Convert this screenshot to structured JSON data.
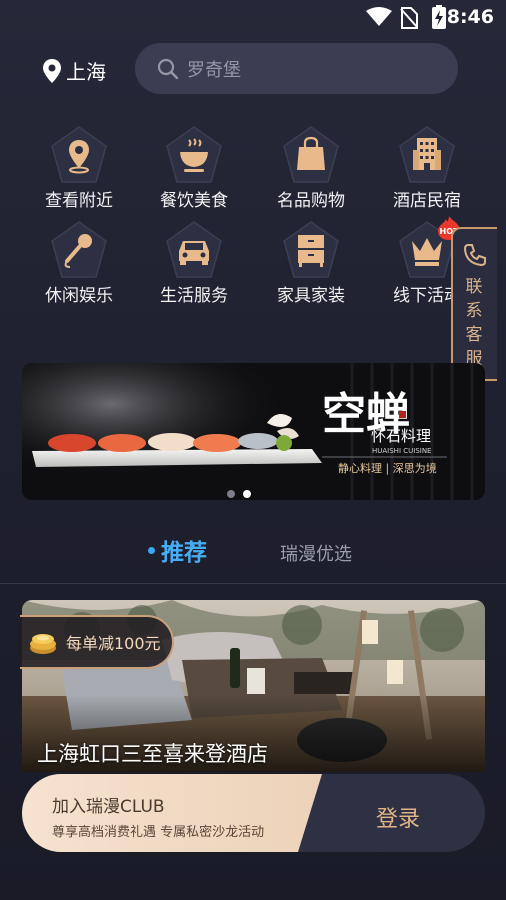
{
  "status_bar": {
    "time": "8:46"
  },
  "header": {
    "location": "上海",
    "search_placeholder": "罗奇堡"
  },
  "categories": [
    {
      "label": "查看附近",
      "icon": "location-pin-icon"
    },
    {
      "label": "餐饮美食",
      "icon": "food-bowl-icon"
    },
    {
      "label": "名品购物",
      "icon": "shopping-bag-icon"
    },
    {
      "label": "酒店民宿",
      "icon": "hotel-building-icon"
    },
    {
      "label": "休闲娱乐",
      "icon": "microphone-icon"
    },
    {
      "label": "生活服务",
      "icon": "car-icon"
    },
    {
      "label": "家具家装",
      "icon": "cabinet-icon"
    },
    {
      "label": "线下活动",
      "icon": "crown-icon"
    }
  ],
  "hot_badge": "HOT",
  "contact": {
    "label": "联系客服"
  },
  "banner": {
    "brand_cn": "空蝉",
    "brand_sub": "怀石料理",
    "brand_en": "HUAISHI CUISINE",
    "slogan": "静心料理 | 深思为境"
  },
  "tabs": {
    "active": "推荐",
    "inactive": "瑞漫优选"
  },
  "hotel": {
    "promo": "每单减100元",
    "name": "上海虹口三至喜来登酒店"
  },
  "club": {
    "title": "加入瑞漫CLUB",
    "subtitle": "尊享高档消费礼遇 专属私密沙龙活动",
    "login": "登录"
  },
  "colors": {
    "accent_blue": "#47aef5",
    "gold": "#d9b38a",
    "background": "#1e1f2d"
  }
}
